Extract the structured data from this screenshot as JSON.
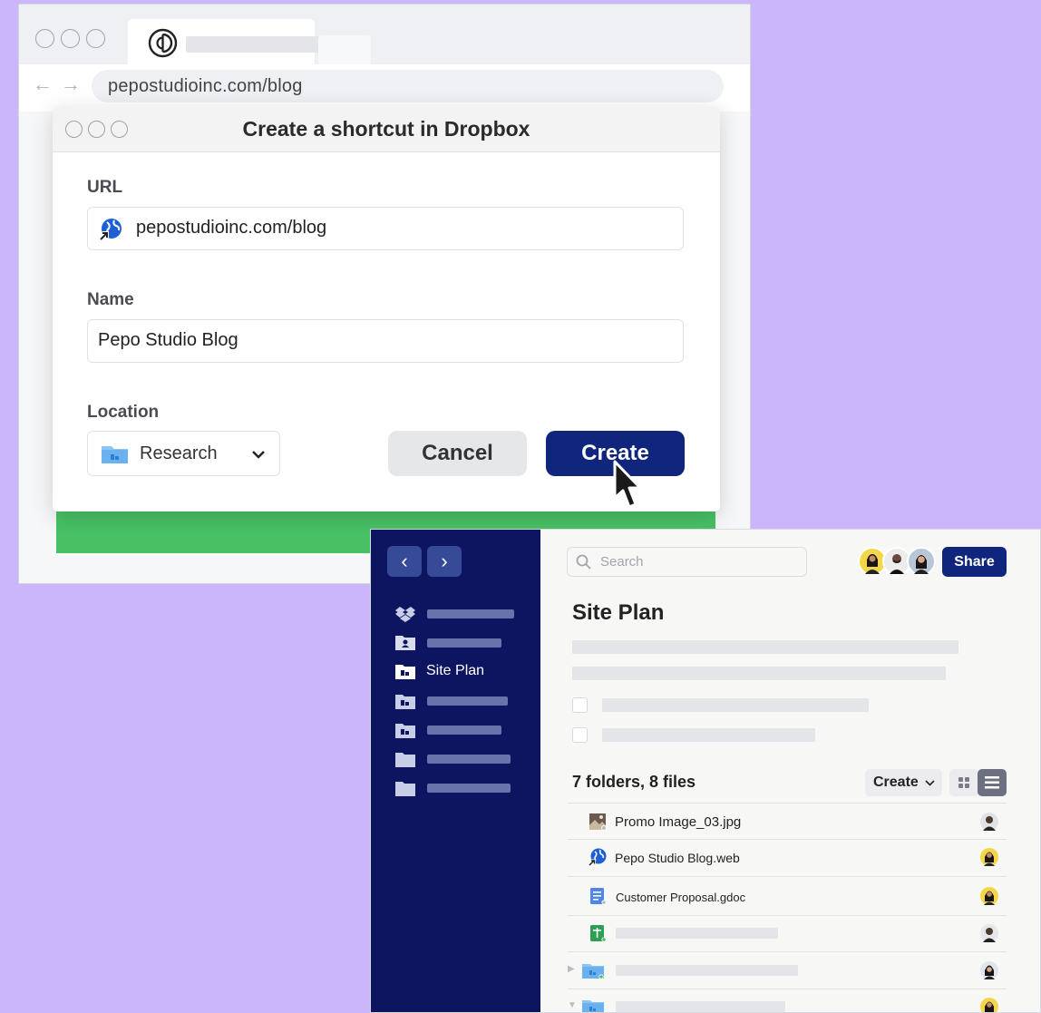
{
  "browser": {
    "address": "pepostudioinc.com/blog",
    "back_icon": "arrow-left-icon",
    "forward_icon": "arrow-right-icon"
  },
  "dialog": {
    "title": "Create a shortcut in Dropbox",
    "url_label": "URL",
    "url_value": "pepostudioinc.com/blog",
    "name_label": "Name",
    "name_value": "Pepo Studio Blog",
    "location_label": "Location",
    "location_value": "Research",
    "cancel_label": "Cancel",
    "create_label": "Create"
  },
  "app": {
    "search_placeholder": "Search",
    "share_label": "Share",
    "sidebar_active_label": "Site Plan",
    "page_title": "Site Plan",
    "summary": "7 folders, 8 files",
    "create_label": "Create",
    "files": [
      {
        "name": "Promo Image_03.jpg"
      },
      {
        "name": "Pepo Studio Blog.web"
      },
      {
        "name": "Customer Proposal.gdoc"
      }
    ]
  },
  "colors": {
    "background": "#cbb5fb",
    "brand_navy": "#0f267c",
    "sidebar": "#0d1560",
    "accent_green": "#48c164"
  }
}
